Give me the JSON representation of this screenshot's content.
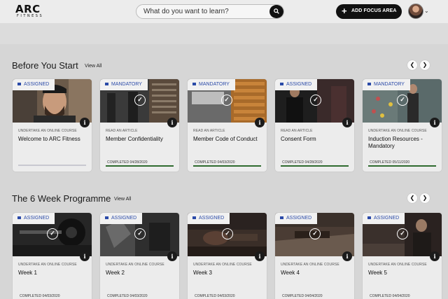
{
  "header": {
    "logo_main": "ARC",
    "logo_sub": "FITNESS",
    "search_placeholder": "What do you want to learn?",
    "add_focus_label": "ADD FOCUS AREA",
    "add_icon": "plus-icon",
    "menu_icon": "chevron-down-icon"
  },
  "sections": [
    {
      "title": "Before You Start",
      "view_all": "View All",
      "cards": [
        {
          "tag": "ASSIGNED",
          "type": "UNDERTAKE AN ONLINE COURSE",
          "title": "Welcome to ARC Fitness",
          "completed": ""
        },
        {
          "tag": "MANDATORY",
          "type": "READ AN ARTICLE",
          "title": "Member Confidentiality",
          "completed": "COMPLETED 04/28/2020"
        },
        {
          "tag": "MANDATORY",
          "type": "READ AN ARTICLE",
          "title": "Member Code of Conduct",
          "completed": "COMPLETED 04/03/2020"
        },
        {
          "tag": "ASSIGNED",
          "type": "READ AN ARTICLE",
          "title": "Consent Form",
          "completed": "COMPLETED 04/28/2020"
        },
        {
          "tag": "MANDATORY",
          "type": "UNDERTAKE AN ONLINE COURSE",
          "title": "Induction Resources - Mandatory",
          "completed": "COMPLETED 05/11/2020"
        }
      ]
    },
    {
      "title": "The 6 Week Programme",
      "view_all": "View All",
      "cards": [
        {
          "tag": "ASSIGNED",
          "type": "UNDERTAKE AN ONLINE COURSE",
          "title": "Week 1",
          "completed": "COMPLETED 04/03/2020"
        },
        {
          "tag": "ASSIGNED",
          "type": "UNDERTAKE AN ONLINE COURSE",
          "title": "Week 2",
          "completed": "COMPLETED 04/03/2020"
        },
        {
          "tag": "ASSIGNED",
          "type": "UNDERTAKE AN ONLINE COURSE",
          "title": "Week 3",
          "completed": "COMPLETED 04/03/2020"
        },
        {
          "tag": "ASSIGNED",
          "type": "UNDERTAKE AN ONLINE COURSE",
          "title": "Week 4",
          "completed": "COMPLETED 04/04/2020"
        },
        {
          "tag": "ASSIGNED",
          "type": "UNDERTAKE AN ONLINE COURSE",
          "title": "Week 5",
          "completed": "COMPLETED 04/04/2020"
        }
      ]
    }
  ],
  "colors": {
    "accent": "#111111",
    "tag_text": "#2a4aa8",
    "progress_complete": "#2f6b2f"
  }
}
